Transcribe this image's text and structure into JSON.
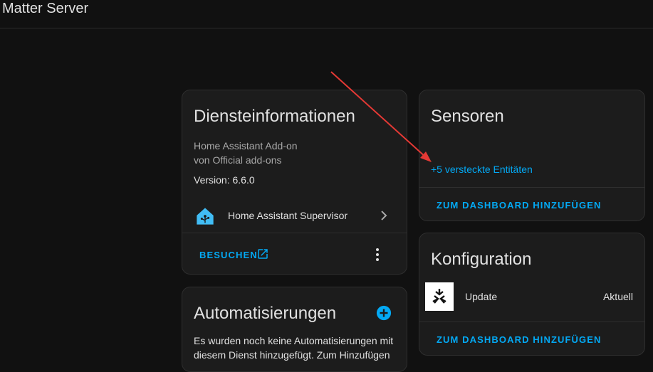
{
  "header": {
    "title": "Matter Server"
  },
  "service_info": {
    "title": "Diensteinformationen",
    "line1": "Home Assistant Add-on",
    "line2": "von Official add-ons",
    "version": "Version: 6.6.0",
    "supervisor_label": "Home Assistant Supervisor",
    "visit_label": "BESUCHEN"
  },
  "sensors": {
    "title": "Sensoren",
    "hidden_entities": "+5 versteckte Entitäten",
    "add_dashboard": "ZUM DASHBOARD HINZUFÜGEN"
  },
  "automations": {
    "title": "Automatisierungen",
    "line1": "Es wurden noch keine Automatisierungen mit",
    "line2": "diesem Dienst hinzugefügt. Zum Hinzufügen"
  },
  "configuration": {
    "title": "Konfiguration",
    "update_label": "Update",
    "update_status": "Aktuell",
    "add_dashboard": "ZUM DASHBOARD HINZUFÜGEN"
  },
  "colors": {
    "accent": "#03a9f4",
    "annotation_arrow": "#e53935",
    "card_background": "#1c1c1c",
    "page_background": "#111111"
  },
  "icons": {
    "supervisor": "home-assistant-icon",
    "visit": "open-in-new-icon",
    "menu": "dots-vertical-icon",
    "add": "plus-circle-icon",
    "chevron": "chevron-right-icon",
    "matter": "matter-logo-icon"
  }
}
